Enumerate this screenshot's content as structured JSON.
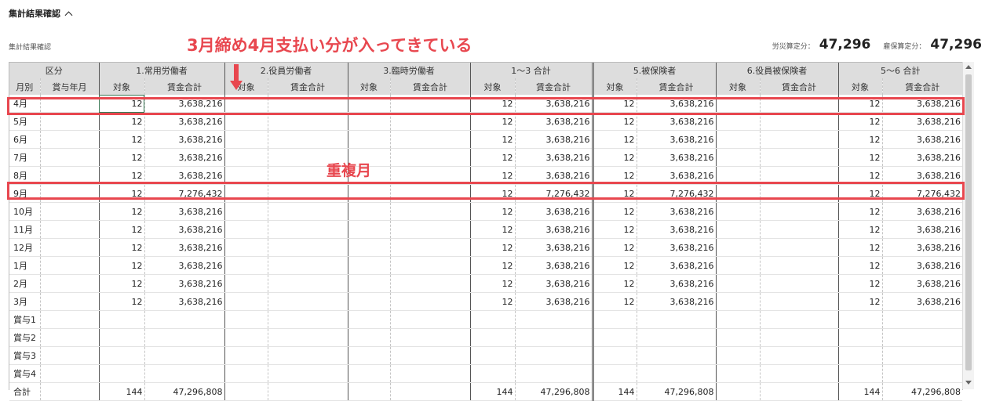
{
  "header": {
    "title": "集計結果確認"
  },
  "subtitle": "集計結果確認",
  "totals": [
    {
      "label": "労災算定分：",
      "value": "47,296"
    },
    {
      "label": "雇保算定分：",
      "value": "47,296"
    }
  ],
  "annotations": {
    "top": "3月締め4月支払い分が入ってきている",
    "middle": "重複月",
    "color": "#e8474f"
  },
  "table": {
    "group_headers": [
      "区分",
      "1.常用労働者",
      "2.役員労働者",
      "3.臨時労働者",
      "1～3 合計",
      "5.被保険者",
      "6.役員被保険者",
      "5～6 合計"
    ],
    "sub_headers": [
      "月別",
      "賞与年月",
      "対象",
      "賃金合計",
      "対象",
      "賃金合計",
      "対象",
      "賃金合計",
      "対象",
      "賃金合計",
      "対象",
      "賃金合計",
      "対象",
      "賃金合計",
      "対象",
      "賃金合計"
    ],
    "rows": [
      {
        "label": "4月",
        "c1": [
          "12",
          "3,638,216"
        ],
        "c4": [
          "12",
          "3,638,216"
        ],
        "c5": [
          "12",
          "3,638,216"
        ],
        "c7": [
          "12",
          "3,638,216"
        ]
      },
      {
        "label": "5月",
        "c1": [
          "12",
          "3,638,216"
        ],
        "c4": [
          "12",
          "3,638,216"
        ],
        "c5": [
          "12",
          "3,638,216"
        ],
        "c7": [
          "12",
          "3,638,216"
        ]
      },
      {
        "label": "6月",
        "c1": [
          "12",
          "3,638,216"
        ],
        "c4": [
          "12",
          "3,638,216"
        ],
        "c5": [
          "12",
          "3,638,216"
        ],
        "c7": [
          "12",
          "3,638,216"
        ]
      },
      {
        "label": "7月",
        "c1": [
          "12",
          "3,638,216"
        ],
        "c4": [
          "12",
          "3,638,216"
        ],
        "c5": [
          "12",
          "3,638,216"
        ],
        "c7": [
          "12",
          "3,638,216"
        ]
      },
      {
        "label": "8月",
        "c1": [
          "12",
          "3,638,216"
        ],
        "c4": [
          "12",
          "3,638,216"
        ],
        "c5": [
          "12",
          "3,638,216"
        ],
        "c7": [
          "12",
          "3,638,216"
        ]
      },
      {
        "label": "9月",
        "c1": [
          "12",
          "7,276,432"
        ],
        "c4": [
          "12",
          "7,276,432"
        ],
        "c5": [
          "12",
          "7,276,432"
        ],
        "c7": [
          "12",
          "7,276,432"
        ]
      },
      {
        "label": "10月",
        "c1": [
          "12",
          "3,638,216"
        ],
        "c4": [
          "12",
          "3,638,216"
        ],
        "c5": [
          "12",
          "3,638,216"
        ],
        "c7": [
          "12",
          "3,638,216"
        ]
      },
      {
        "label": "11月",
        "c1": [
          "12",
          "3,638,216"
        ],
        "c4": [
          "12",
          "3,638,216"
        ],
        "c5": [
          "12",
          "3,638,216"
        ],
        "c7": [
          "12",
          "3,638,216"
        ]
      },
      {
        "label": "12月",
        "c1": [
          "12",
          "3,638,216"
        ],
        "c4": [
          "12",
          "3,638,216"
        ],
        "c5": [
          "12",
          "3,638,216"
        ],
        "c7": [
          "12",
          "3,638,216"
        ]
      },
      {
        "label": "1月",
        "c1": [
          "12",
          "3,638,216"
        ],
        "c4": [
          "12",
          "3,638,216"
        ],
        "c5": [
          "12",
          "3,638,216"
        ],
        "c7": [
          "12",
          "3,638,216"
        ]
      },
      {
        "label": "2月",
        "c1": [
          "12",
          "3,638,216"
        ],
        "c4": [
          "12",
          "3,638,216"
        ],
        "c5": [
          "12",
          "3,638,216"
        ],
        "c7": [
          "12",
          "3,638,216"
        ]
      },
      {
        "label": "3月",
        "c1": [
          "12",
          "3,638,216"
        ],
        "c4": [
          "12",
          "3,638,216"
        ],
        "c5": [
          "12",
          "3,638,216"
        ],
        "c7": [
          "12",
          "3,638,216"
        ]
      },
      {
        "label": "賞与1"
      },
      {
        "label": "賞与2"
      },
      {
        "label": "賞与3"
      },
      {
        "label": "賞与4"
      },
      {
        "label": "合計",
        "c1": [
          "144",
          "47,296,808"
        ],
        "c4": [
          "144",
          "47,296,808"
        ],
        "c5": [
          "144",
          "47,296,808"
        ],
        "c7": [
          "144",
          "47,296,808"
        ]
      }
    ]
  }
}
